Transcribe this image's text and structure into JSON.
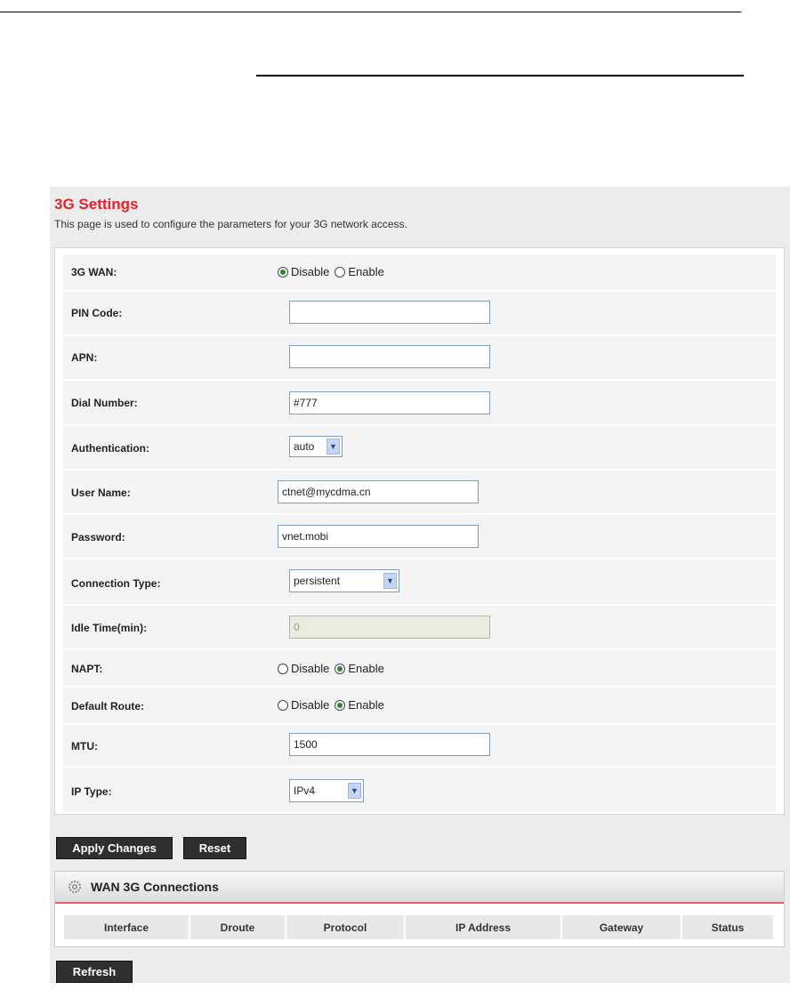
{
  "page": {
    "title": "3G Settings",
    "description": "This page is used to configure the parameters for your 3G network access."
  },
  "form": {
    "wan": {
      "label": "3G WAN:",
      "options": [
        "Disable",
        "Enable"
      ],
      "selected": "Disable"
    },
    "pin": {
      "label": "PIN Code:",
      "value": ""
    },
    "apn": {
      "label": "APN:",
      "value": ""
    },
    "dial": {
      "label": "Dial Number:",
      "value": "#777"
    },
    "auth": {
      "label": "Authentication:",
      "value": "auto"
    },
    "user": {
      "label": "User Name:",
      "value": "ctnet@mycdma.cn"
    },
    "password": {
      "label": "Password:",
      "value": "vnet.mobi"
    },
    "conn_type": {
      "label": "Connection Type:",
      "value": "persistent"
    },
    "idle": {
      "label": "Idle Time(min):",
      "value": "0"
    },
    "napt": {
      "label": "NAPT:",
      "options": [
        "Disable",
        "Enable"
      ],
      "selected": "Enable"
    },
    "default_route": {
      "label": "Default Route:",
      "options": [
        "Disable",
        "Enable"
      ],
      "selected": "Enable"
    },
    "mtu": {
      "label": "MTU:",
      "value": "1500"
    },
    "ip_type": {
      "label": "IP Type:",
      "value": "IPv4"
    }
  },
  "buttons": {
    "apply": "Apply Changes",
    "reset": "Reset",
    "refresh": "Refresh"
  },
  "connections": {
    "title": "WAN 3G Connections",
    "columns": [
      "Interface",
      "Droute",
      "Protocol",
      "IP Address",
      "Gateway",
      "Status"
    ]
  },
  "colors": {
    "title_red": "#e4212a",
    "button_dark": "#2f2f2f",
    "header_accent": "#e06070"
  }
}
